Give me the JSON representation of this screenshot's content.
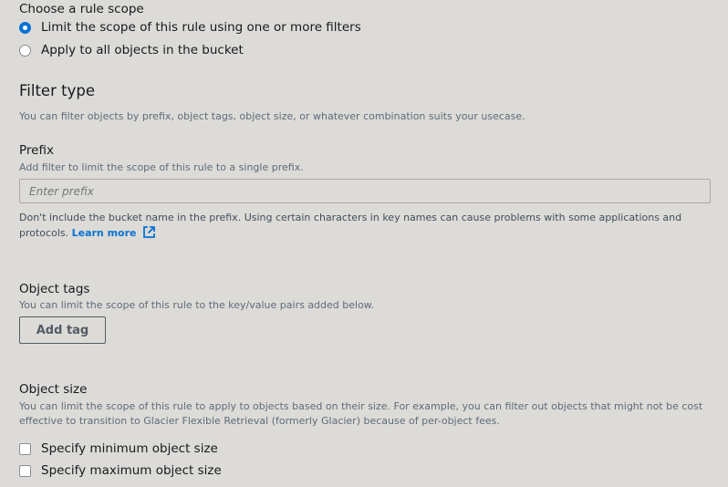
{
  "scope": {
    "heading": "Choose a rule scope",
    "options": [
      {
        "label": "Limit the scope of this rule using one or more filters",
        "selected": true
      },
      {
        "label": "Apply to all objects in the bucket",
        "selected": false
      }
    ]
  },
  "filter_type": {
    "heading": "Filter type",
    "description": "You can filter objects by prefix, object tags, object size, or whatever combination suits your usecase."
  },
  "prefix": {
    "label": "Prefix",
    "description": "Add filter to limit the scope of this rule to a single prefix.",
    "placeholder": "Enter prefix",
    "value": "",
    "help_line1": "Don't include the bucket name in the prefix. Using certain characters in key names can cause problems with some applications and",
    "help_line2": "protocols.",
    "learn_more": "Learn more"
  },
  "tags": {
    "label": "Object tags",
    "description": "You can limit the scope of this rule to the key/value pairs added below.",
    "add_button": "Add tag"
  },
  "size": {
    "label": "Object size",
    "description_line1": "You can limit the scope of this rule to apply to objects based on their size. For example, you can filter out objects that might not be cost",
    "description_line2": "effective to transition to Glacier Flexible Retrieval (formerly Glacier) because of per-object fees.",
    "options": [
      {
        "label": "Specify minimum object size",
        "checked": false
      },
      {
        "label": "Specify maximum object size",
        "checked": false
      }
    ]
  },
  "colors": {
    "accent": "#0972d3",
    "background": "#dcdbd7"
  },
  "icons": {
    "external_link": "external-link-icon"
  }
}
